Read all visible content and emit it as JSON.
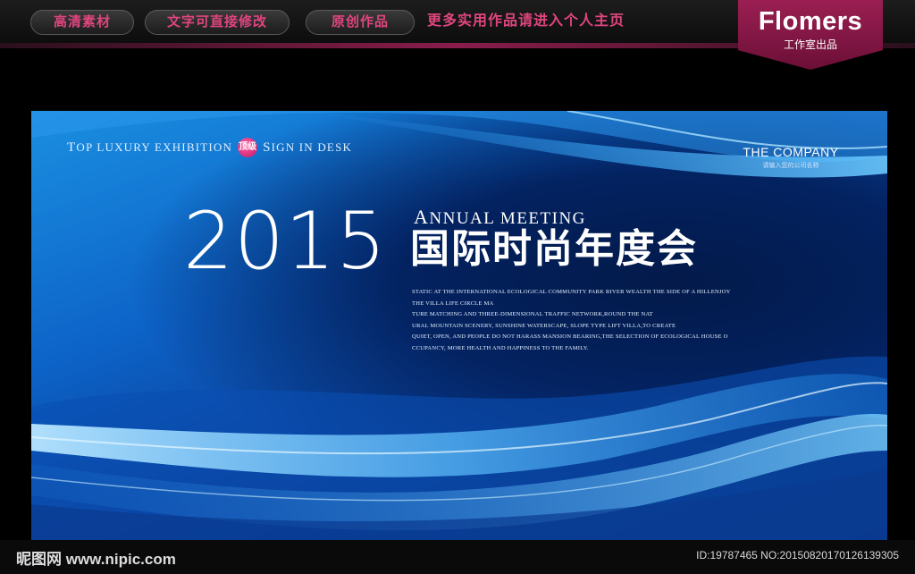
{
  "topbar": {
    "pills": [
      "高清素材",
      "文字可直接修改",
      "原创作品"
    ],
    "promo": "更多实用作品请进入个人主页",
    "brand": {
      "name": "Flomers",
      "sub": "工作室出品"
    }
  },
  "banner": {
    "tagline": {
      "part1_cap": "T",
      "part1_rest": "OP LUXURY EXHIBITION",
      "badge": "顶级",
      "part2_cap": "S",
      "part2_rest": "IGN IN DESK"
    },
    "company": {
      "name": "THE COMPANY",
      "sub": "请输入您的公司名称"
    },
    "year": "2015",
    "annual": {
      "cap": "A",
      "rest": "NNUAL MEETING"
    },
    "title_cn": "国际时尚年度会",
    "body_lines": [
      "STATIC AT THE INTERNATIONAL ECOLOGICAL COMMUNITY PARK RIVER WEALTH THE SIDE OF A HILLENJOY",
      "THE VILLA LIFE CIRCLE MA",
      "TURE MATCHING AND THREE-DIMENSIONAL TRAFFIC NETWORK,ROUND THE NAT",
      "URAL MOUNTAIN SCENERY, SUNSHINE WATERSCAPE, SLOPE TYPE LIFT VILLA,TO CREATE",
      "QUIET, OPEN, AND PEOPLE DO NOT HARASS MANSION BEARING,THE SELECTION OF ECOLOGICAL HOUSE O",
      "CCUPANCY, MORE HEALTH AND HAPPINESS TO THE FAMILY."
    ]
  },
  "watermark": {
    "logo": "昵图网 www.nipic.com",
    "id": "ID:19787465 NO:20150820170126139305"
  },
  "colors": {
    "accent_pink": "#e0457f",
    "brand_bg": "#8a1a48",
    "banner_blue": "#0d63c8"
  }
}
